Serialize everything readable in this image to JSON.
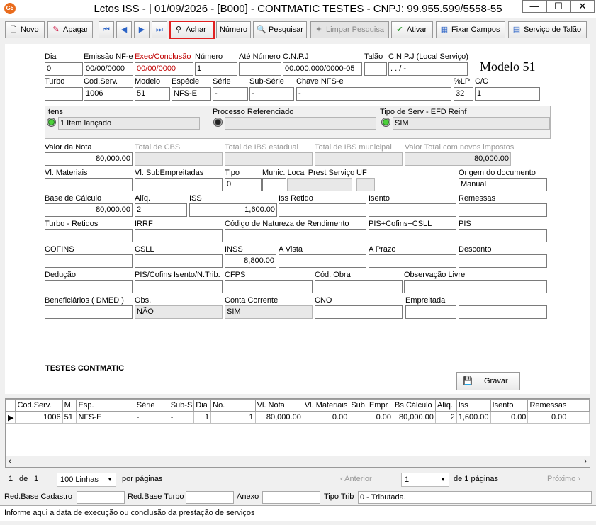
{
  "window": {
    "logo": "G5",
    "title": "Lctos ISS - |  01/09/2026 - [B000] - CONTMATIC  TESTES - CNPJ: 99.955.599/5558-55",
    "minimize": "—",
    "maximize": "☐",
    "close": "✕"
  },
  "toolbar": {
    "novo": "Novo",
    "apagar": "Apagar",
    "achar": "Achar",
    "numero": "Número",
    "pesquisar": "Pesquisar",
    "limpar": "Limpar Pesquisa",
    "ativar": "Ativar",
    "fixar": "Fixar Campos",
    "servico": "Serviço de Talão"
  },
  "form": {
    "modelo_label": "Modelo 51",
    "dia": {
      "label": "Dia",
      "value": "0"
    },
    "emissao": {
      "label": "Emissão NF-e",
      "value": "00/00/0000"
    },
    "exec": {
      "label": "Exec/Conclusão",
      "value": "00/00/0000"
    },
    "numero": {
      "label": "Número",
      "value": "1"
    },
    "ate_numero": {
      "label": "Até Número",
      "value": ""
    },
    "cnpj": {
      "label": "C.N.P.J",
      "value": "00.000.000/0000-05"
    },
    "talao": {
      "label": "Talão",
      "value": ""
    },
    "cnpj_local": {
      "label": "C.N.P.J (Local Serviço)",
      "value": "  .    .    /    -"
    },
    "turbo": {
      "label": "Turbo",
      "value": ""
    },
    "cod_serv": {
      "label": "Cod.Serv.",
      "value": "1006"
    },
    "modelo": {
      "label": "Modelo",
      "value": "51"
    },
    "especie": {
      "label": "Espécie",
      "value": "NFS-E"
    },
    "serie": {
      "label": "Série",
      "value": "-"
    },
    "sub_serie": {
      "label": "Sub-Série",
      "value": "-"
    },
    "chave": {
      "label": "Chave NFS-e",
      "value": "-"
    },
    "lp": {
      "label": "%LP",
      "value": "32"
    },
    "cc": {
      "label": "C/C",
      "value": "1"
    },
    "itens": {
      "label": "Itens",
      "value": "1 Item lançado"
    },
    "processo": {
      "label": "Processo Referenciado",
      "value": ""
    },
    "tipo_serv": {
      "label": "Tipo de Serv - EFD Reinf",
      "value": "SIM"
    },
    "valor_nota": {
      "label": "Valor da Nota",
      "value": "80,000.00"
    },
    "total_cbs": {
      "label": "Total de CBS",
      "value": ""
    },
    "total_ibs_est": {
      "label": "Total de IBS estadual",
      "value": ""
    },
    "total_ibs_mun": {
      "label": "Total de IBS municipal",
      "value": ""
    },
    "valor_total_novos": {
      "label": "Valor Total com novos impostos",
      "value": "80,000.00"
    },
    "vl_materiais": {
      "label": "Vl. Materiais",
      "value": ""
    },
    "vl_subempreitadas": {
      "label": "Vl. SubEmpreitadas",
      "value": ""
    },
    "tipo": {
      "label": "Tipo",
      "value": "0"
    },
    "munic_local": {
      "label": "Munic. Local Prest Serviço",
      "value": ""
    },
    "uf": {
      "label": "UF",
      "value": ""
    },
    "origem": {
      "label": "Origem do documento",
      "value": "Manual"
    },
    "base_calculo": {
      "label": "Base de Cálculo",
      "value": "80,000.00"
    },
    "aliq": {
      "label": "Alíq.",
      "value": "2"
    },
    "iss": {
      "label": "ISS",
      "value": "1,600.00"
    },
    "iss_retido": {
      "label": "Iss Retido",
      "value": ""
    },
    "isento": {
      "label": "Isento",
      "value": ""
    },
    "remessas": {
      "label": "Remessas",
      "value": ""
    },
    "turbo_retidos": {
      "label": "Turbo - Retidos",
      "value": ""
    },
    "irrf": {
      "label": "IRRF",
      "value": ""
    },
    "cod_natureza": {
      "label": "Código de Natureza de Rendimento",
      "value": ""
    },
    "pis_cofins_csll": {
      "label": "PIS+Cofins+CSLL",
      "value": ""
    },
    "pis": {
      "label": "PIS",
      "value": ""
    },
    "cofins": {
      "label": "COFINS",
      "value": ""
    },
    "csll": {
      "label": "CSLL",
      "value": ""
    },
    "inss": {
      "label": "INSS",
      "value": "8,800.00"
    },
    "a_vista": {
      "label": "A Vista",
      "value": ""
    },
    "a_prazo": {
      "label": "A Prazo",
      "value": ""
    },
    "desconto": {
      "label": "Desconto",
      "value": ""
    },
    "deducao": {
      "label": "Dedução",
      "value": ""
    },
    "pis_cofins_isento": {
      "label": "PIS/Cofins Isento/N.Trib.",
      "value": ""
    },
    "cfps": {
      "label": "CFPS",
      "value": ""
    },
    "cod_obra": {
      "label": "Cód. Obra",
      "value": ""
    },
    "obs_livre": {
      "label": "Observação Livre",
      "value": ""
    },
    "beneficiarios": {
      "label": "Beneficiários ( DMED )",
      "value": ""
    },
    "obs": {
      "label": "Obs.",
      "value": "NÃO"
    },
    "conta_corrente": {
      "label": "Conta Corrente",
      "value": "SIM"
    },
    "cno": {
      "label": "CNO",
      "value": ""
    },
    "empreitada": {
      "label": "Empreitada",
      "value": ""
    },
    "company": "TESTES CONTMATIC",
    "gravar": "Gravar"
  },
  "grid": {
    "columns": [
      "Cod.Serv.",
      "M.",
      "Esp.",
      "Série",
      "Sub-S",
      "Dia",
      "No.",
      "Vl. Nota",
      "Vl. Materiais",
      "Sub. Empr",
      "Bs Cálculo",
      "Alíq.",
      "Iss",
      "Isento",
      "Remessas"
    ],
    "rows": [
      [
        "1006",
        "51",
        "NFS-E",
        "-",
        "-",
        "1",
        "1",
        "80,000.00",
        "0.00",
        "0.00",
        "80,000.00",
        "2",
        "1,600.00",
        "0.00",
        "0.00"
      ]
    ],
    "row_marker": "▶"
  },
  "pager": {
    "page": "1",
    "of_label": "de",
    "total": "1",
    "lines": "100 Linhas",
    "per_page": "por páginas",
    "anterior": "Anterior",
    "current": "1",
    "de_paginas": "de 1 páginas",
    "proximo": "Próximo"
  },
  "status": {
    "red_base_cadastro": "Red.Base Cadastro",
    "red_base_turbo": "Red.Base Turbo",
    "anexo": "Anexo",
    "tipo_trib": "Tipo Trib",
    "tipo_trib_value": "0  - Tributada."
  },
  "hint": "Informe aqui a data de execução ou conclusão da prestação de serviços"
}
